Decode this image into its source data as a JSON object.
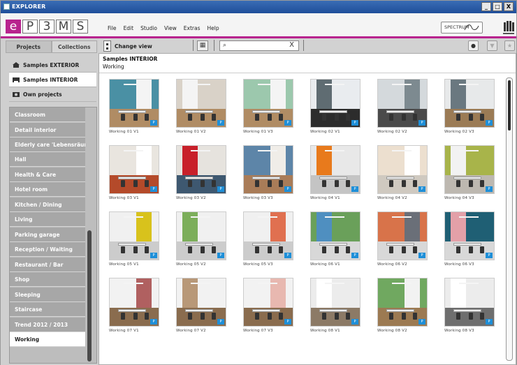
{
  "window": {
    "title": "EXPLORER",
    "buttons": [
      "_",
      "□",
      "X"
    ]
  },
  "logo": {
    "letters": [
      "e",
      "P",
      "3",
      "M",
      "S"
    ]
  },
  "menu": [
    "File",
    "Edit",
    "Studio",
    "View",
    "Extras",
    "Help"
  ],
  "spectrum_label": "SPECTRUM",
  "sidebar": {
    "tabs": [
      "Projects",
      "Collections"
    ],
    "sources": [
      {
        "label": "Samples EXTERIOR",
        "icon": "house-icon"
      },
      {
        "label": "Samples INTERIOR",
        "icon": "sofa-icon"
      },
      {
        "label": "Own projects",
        "icon": "camera-icon"
      }
    ],
    "categories": [
      "Classroom",
      "Detail interior",
      "Elderly care 'Lebensräume'",
      "Hall",
      "Health & Care",
      "Hotel room",
      "Kitchen / Dining",
      "Living",
      "Parking garage",
      "Reception / Waiting",
      "Restaurant / Bar",
      "Shop",
      "Sleeping",
      "Staircase",
      "Trend 2012 / 2013",
      "Working"
    ],
    "selected_category": "Working"
  },
  "toolbar": {
    "change_view": "Change view",
    "search_placeholder": "",
    "search_clear": "X"
  },
  "breadcrumb": {
    "title": "Samples INTERIOR",
    "subtitle": "Working"
  },
  "thumbnails": [
    {
      "label": "Working 01 V1",
      "wall": "#4a90a4",
      "wall2": "#f4f4f4",
      "floor": "#b08c64"
    },
    {
      "label": "Working 01 V2",
      "wall": "#d9d2c8",
      "wall2": "#f4f4f4",
      "floor": "#b08c64"
    },
    {
      "label": "Working 01 V3",
      "wall": "#9cc8ad",
      "wall2": "#f4f4f4",
      "floor": "#b08c64"
    },
    {
      "label": "Working 02 V1",
      "wall": "#e9ecef",
      "wall2": "#5f6c72",
      "floor": "#2c2c2c"
    },
    {
      "label": "Working 02 V2",
      "wall": "#d4d9dc",
      "wall2": "#7d8a90",
      "floor": "#4a4a4a"
    },
    {
      "label": "Working 02 V3",
      "wall": "#e7e9ea",
      "wall2": "#6a7880",
      "floor": "#9b7b55"
    },
    {
      "label": "Working 03 V1",
      "wall": "#e9e5df",
      "wall2": "#ffffff",
      "floor": "#b44a2a"
    },
    {
      "label": "Working 03 V2",
      "wall": "#e6e3de",
      "wall2": "#c8202a",
      "floor": "#3e5870"
    },
    {
      "label": "Working 03 V3",
      "wall": "#5d85a8",
      "wall2": "#f0ede8",
      "floor": "#a97c58"
    },
    {
      "label": "Working 04 V1",
      "wall": "#e8e8e8",
      "wall2": "#e87a1c",
      "floor": "#c4c4c4"
    },
    {
      "label": "Working 04 V2",
      "wall": "#ecdfcf",
      "wall2": "#ffffff",
      "floor": "#cfc9c0"
    },
    {
      "label": "Working 04 V3",
      "wall": "#a8b44a",
      "wall2": "#f2f2f2",
      "floor": "#bdb8b0"
    },
    {
      "label": "Working 05 V1",
      "wall": "#f0f0f0",
      "wall2": "#d8c21c",
      "floor": "#cccccc"
    },
    {
      "label": "Working 05 V2",
      "wall": "#f0f0f0",
      "wall2": "#7cae5a",
      "floor": "#cccccc"
    },
    {
      "label": "Working 05 V3",
      "wall": "#f0f0f0",
      "wall2": "#e07050",
      "floor": "#cccccc"
    },
    {
      "label": "Working 06 V1",
      "wall": "#6aa05a",
      "wall2": "#4f8fc0",
      "floor": "#d8d8d8"
    },
    {
      "label": "Working 06 V2",
      "wall": "#d8734a",
      "wall2": "#6a6f78",
      "floor": "#d8d8d8"
    },
    {
      "label": "Working 06 V3",
      "wall": "#1f5f74",
      "wall2": "#e3a0a8",
      "floor": "#d8d8d8"
    },
    {
      "label": "Working 07 V1",
      "wall": "#f2f2f2",
      "wall2": "#b06060",
      "floor": "#8a6c4e"
    },
    {
      "label": "Working 07 V2",
      "wall": "#f2f2f2",
      "wall2": "#b89878",
      "floor": "#8a6c4e"
    },
    {
      "label": "Working 07 V3",
      "wall": "#f2f2f2",
      "wall2": "#e8b8b0",
      "floor": "#8a6c4e"
    },
    {
      "label": "Working 08 V1",
      "wall": "#ececec",
      "wall2": "#ffffff",
      "floor": "#8c7a66"
    },
    {
      "label": "Working 08 V2",
      "wall": "#70a860",
      "wall2": "#f2f2f2",
      "floor": "#9c7a52"
    },
    {
      "label": "Working 08 V3",
      "wall": "#ececec",
      "wall2": "#ffffff",
      "floor": "#6e6e6e"
    }
  ],
  "colors": {
    "accent": "#b8238e",
    "flag": "#1e8fd8"
  }
}
